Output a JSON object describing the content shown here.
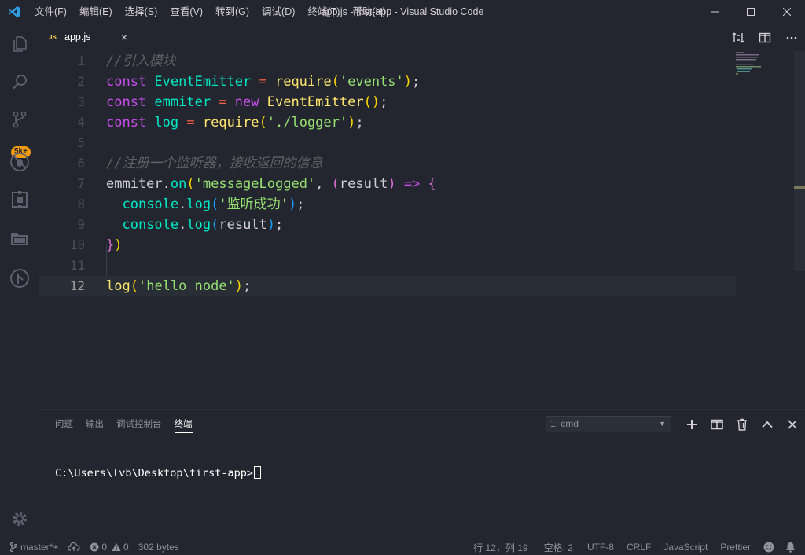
{
  "window": {
    "title": "app.js - first-app - Visual Studio Code"
  },
  "menu": [
    "文件(F)",
    "编辑(E)",
    "选择(S)",
    "查看(V)",
    "转到(G)",
    "调试(D)",
    "终端(T)",
    "帮助(H)"
  ],
  "activity": {
    "scm_badge": "5k+"
  },
  "tab": {
    "icon_text": "JS",
    "title": "app.js",
    "close": "×"
  },
  "editor": {
    "current_line": 12,
    "line_numbers": [
      "1",
      "2",
      "3",
      "4",
      "5",
      "6",
      "7",
      "8",
      "9",
      "10",
      "11",
      "12"
    ],
    "lines": [
      [
        [
          "c",
          "//引入模块"
        ]
      ],
      [
        [
          "k",
          "const "
        ],
        [
          "v",
          "EventEmitter"
        ],
        [
          "o",
          " = "
        ],
        [
          "f",
          "require"
        ],
        [
          "b1",
          "("
        ],
        [
          "s",
          "'events'"
        ],
        [
          "b1",
          ")"
        ],
        [
          "p",
          ";"
        ]
      ],
      [
        [
          "k",
          "const "
        ],
        [
          "v",
          "emmiter"
        ],
        [
          "o",
          " = "
        ],
        [
          "k",
          "new "
        ],
        [
          "cl",
          "EventEmitter"
        ],
        [
          "b1",
          "()"
        ],
        [
          "p",
          ";"
        ]
      ],
      [
        [
          "k",
          "const "
        ],
        [
          "v",
          "log"
        ],
        [
          "o",
          " = "
        ],
        [
          "f",
          "require"
        ],
        [
          "b1",
          "("
        ],
        [
          "s",
          "'./logger'"
        ],
        [
          "b1",
          ")"
        ],
        [
          "p",
          ";"
        ]
      ],
      [],
      [
        [
          "c",
          "//注册一个监听器，接收返回的信息"
        ]
      ],
      [
        [
          "g",
          "emmiter"
        ],
        [
          "p",
          "."
        ],
        [
          "m",
          "on"
        ],
        [
          "b1",
          "("
        ],
        [
          "s",
          "'messageLogged'"
        ],
        [
          "p",
          ", "
        ],
        [
          "b2",
          "("
        ],
        [
          "g",
          "result"
        ],
        [
          "b2",
          ")"
        ],
        [
          "k",
          " => "
        ],
        [
          "b2",
          "{"
        ]
      ],
      [
        [
          "p",
          "  "
        ],
        [
          "v",
          "console"
        ],
        [
          "p",
          "."
        ],
        [
          "m",
          "log"
        ],
        [
          "b3",
          "("
        ],
        [
          "s",
          "'监听成功'"
        ],
        [
          "b3",
          ")"
        ],
        [
          "p",
          ";"
        ]
      ],
      [
        [
          "p",
          "  "
        ],
        [
          "v",
          "console"
        ],
        [
          "p",
          "."
        ],
        [
          "m",
          "log"
        ],
        [
          "b3",
          "("
        ],
        [
          "g",
          "result"
        ],
        [
          "b3",
          ")"
        ],
        [
          "p",
          ";"
        ]
      ],
      [
        [
          "b2",
          "}"
        ],
        [
          "b1",
          ")"
        ]
      ],
      [],
      [
        [
          "f",
          "log"
        ],
        [
          "b1",
          "("
        ],
        [
          "s",
          "'hello node'"
        ],
        [
          "b1",
          ")"
        ],
        [
          "p",
          ";"
        ]
      ]
    ]
  },
  "panel": {
    "tabs": [
      "问题",
      "输出",
      "调试控制台",
      "终端"
    ],
    "active_tab": "终端",
    "terminal_select": "1: cmd",
    "terminal_text": "C:\\Users\\lvb\\Desktop\\first-app>"
  },
  "status": {
    "branch": "master*+",
    "errors": "0",
    "warnings": "0",
    "size": "302 bytes",
    "position": "行 12，列 19",
    "spaces": "空格: 2",
    "encoding": "UTF-8",
    "eol": "CRLF",
    "language": "JavaScript",
    "formatter": "Prettier"
  },
  "colors": {
    "background": "#23262e",
    "keyword": "#c74ded",
    "variable": "#00e8c6",
    "function": "#ffe66d",
    "string": "#96e072",
    "badge": "#f39c12"
  }
}
